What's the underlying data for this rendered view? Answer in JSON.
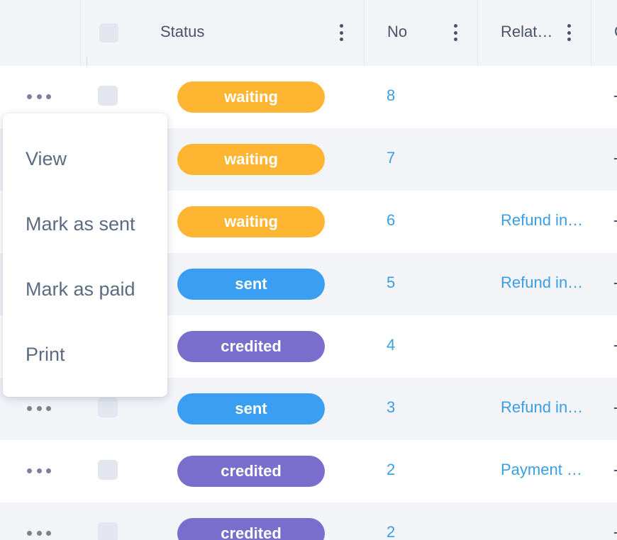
{
  "columns": {
    "status": "Status",
    "no": "No",
    "related": "Relat…",
    "next_initial": "C"
  },
  "status_colors": {
    "waiting": "#fdb532",
    "sent": "#3a9ef2",
    "credited": "#7a6ecc"
  },
  "rows": [
    {
      "status": "waiting",
      "no": "8",
      "related": ""
    },
    {
      "status": "waiting",
      "no": "7",
      "related": ""
    },
    {
      "status": "waiting",
      "no": "6",
      "related": "Refund in…"
    },
    {
      "status": "sent",
      "no": "5",
      "related": "Refund in…"
    },
    {
      "status": "credited",
      "no": "4",
      "related": ""
    },
    {
      "status": "sent",
      "no": "3",
      "related": "Refund in…"
    },
    {
      "status": "credited",
      "no": "2",
      "related": "Payment …"
    },
    {
      "status": "credited",
      "no": "2",
      "related": ""
    }
  ],
  "menu": {
    "items": [
      "View",
      "Mark as sent",
      "Mark as paid",
      "Print"
    ]
  }
}
